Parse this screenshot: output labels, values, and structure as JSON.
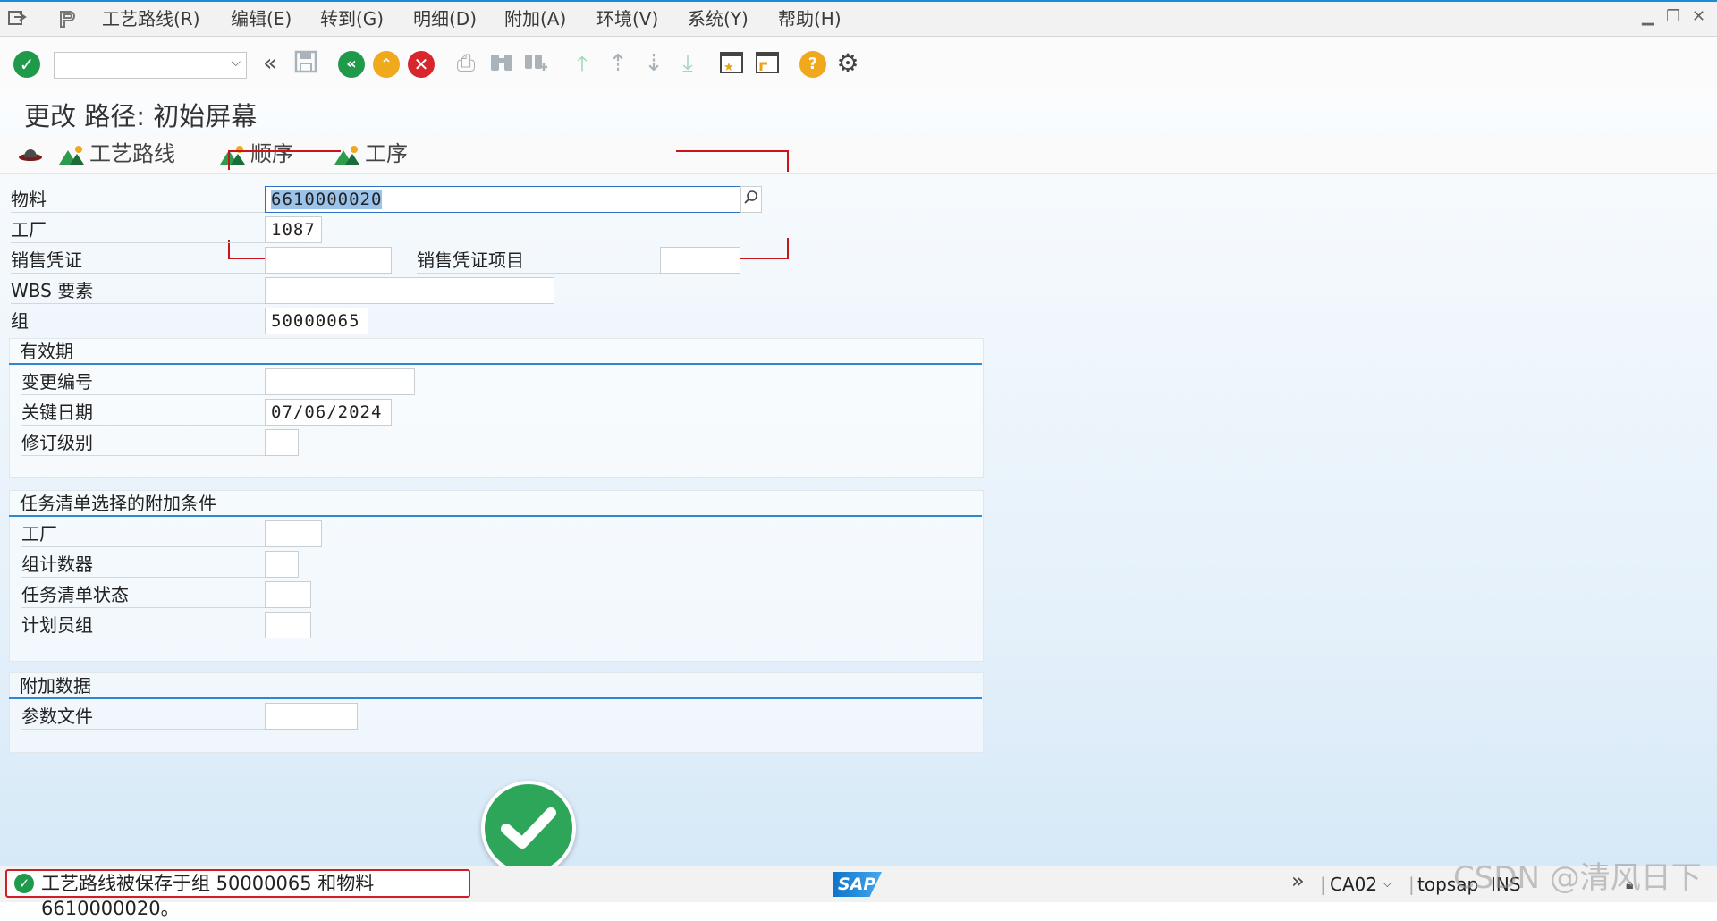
{
  "menubar": {
    "items": [
      "工艺路线(R)",
      "编辑(E)",
      "转到(G)",
      "明细(D)",
      "附加(A)",
      "环境(V)",
      "系统(Y)",
      "帮助(H)"
    ]
  },
  "toolbar": {
    "command_value": ""
  },
  "page": {
    "title": "更改 路径: 初始屏幕"
  },
  "appbar": {
    "items": [
      "工艺路线",
      "顺序",
      "工序"
    ]
  },
  "form": {
    "material_label": "物料",
    "material_value": "6610000020",
    "plant_label": "工厂",
    "plant_value": "1087",
    "sales_doc_label": "销售凭证",
    "sales_doc_value": "",
    "sales_item_label": "销售凭证项目",
    "sales_item_value": "",
    "wbs_label": "WBS 要素",
    "wbs_value": "",
    "group_label": "组",
    "group_value": "50000065"
  },
  "validity": {
    "title": "有效期",
    "change_no_label": "变更编号",
    "change_no_value": "",
    "key_date_label": "关键日期",
    "key_date_value": "07/06/2024",
    "revision_label": "修订级别",
    "revision_value": ""
  },
  "criteria": {
    "title": "任务清单选择的附加条件",
    "plant_label": "工厂",
    "plant_value": "",
    "counter_label": "组计数器",
    "counter_value": "",
    "status_label": "任务清单状态",
    "status_value": "",
    "planner_label": "计划员组",
    "planner_value": ""
  },
  "additional": {
    "title": "附加数据",
    "profile_label": "参数文件",
    "profile_value": ""
  },
  "statusbar": {
    "message": "工艺路线被保存于组 50000065 和物料 6610000020。",
    "transaction": "CA02",
    "system": "topsap",
    "mode": "INS",
    "sap_logo": "SAP"
  },
  "watermark": "CSDN @清风日下",
  "colors": {
    "accent": "#1b8bd9",
    "ok_green": "#1f9a4a",
    "error_red": "#d11e25",
    "group_line": "#2f88cf",
    "selection": "#9bc3ea"
  }
}
